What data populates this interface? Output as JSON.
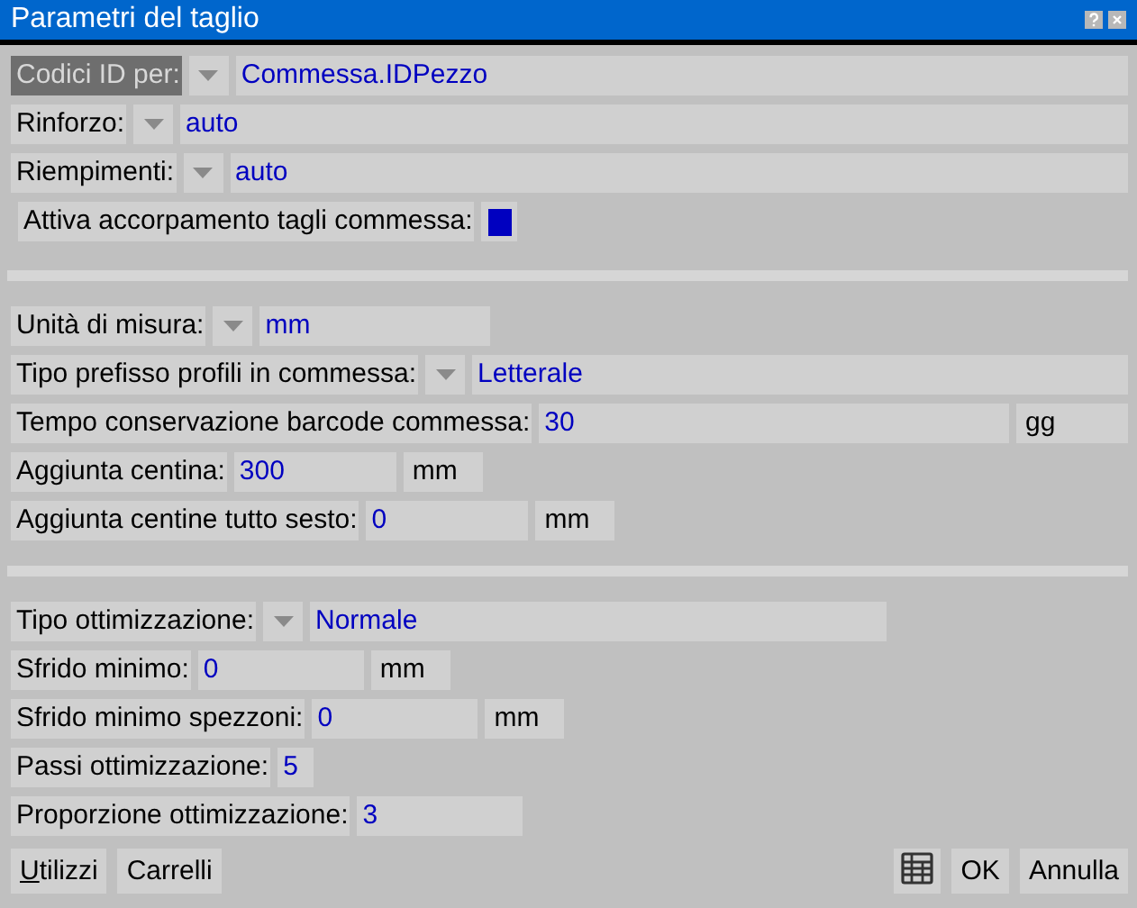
{
  "window": {
    "title": "Parametri del taglio"
  },
  "sections": [
    {
      "rows": [
        {
          "kind": "dropdown",
          "label": "Codici ID per:",
          "focused": true,
          "value": "Commessa.IDPezzo"
        },
        {
          "kind": "dropdown",
          "label": "Rinforzo:",
          "focused": false,
          "value": "auto"
        },
        {
          "kind": "dropdown",
          "label": "Riempimenti:",
          "focused": false,
          "value": "auto"
        },
        {
          "kind": "checkbox",
          "label": "Attiva accorpamento tagli commessa:",
          "focused": false,
          "checked": true
        }
      ]
    },
    {
      "rows": [
        {
          "kind": "dropdown",
          "label": "Unità di misura:",
          "focused": false,
          "value": "mm"
        },
        {
          "kind": "dropdown",
          "label": "Tipo prefisso profili in commessa:",
          "focused": false,
          "value": "Letterale"
        },
        {
          "kind": "text",
          "label": "Tempo conservazione barcode commessa:",
          "focused": false,
          "value": "30",
          "unit": "gg"
        },
        {
          "kind": "text",
          "label": "Aggiunta centina:",
          "focused": false,
          "value": "300",
          "unit": "mm"
        },
        {
          "kind": "text",
          "label": "Aggiunta centine tutto sesto:",
          "focused": false,
          "value": "0",
          "unit": "mm"
        }
      ]
    },
    {
      "rows": [
        {
          "kind": "dropdown",
          "label": "Tipo ottimizzazione:",
          "focused": false,
          "value": "Normale"
        },
        {
          "kind": "text",
          "label": "Sfrido minimo:",
          "focused": false,
          "value": "0",
          "unit": "mm"
        },
        {
          "kind": "text",
          "label": "Sfrido minimo spezzoni:",
          "focused": false,
          "value": "0",
          "unit": "mm"
        },
        {
          "kind": "text",
          "label": "Passi ottimizzazione:",
          "focused": false,
          "value": "5"
        },
        {
          "kind": "text",
          "label": "Proporzione ottimizzazione:",
          "focused": false,
          "value": "3"
        }
      ]
    }
  ],
  "buttons_left": [
    {
      "label": "Utilizzi",
      "mnemonic_underlined": true
    },
    {
      "label": "Carrelli",
      "mnemonic_underlined": false
    }
  ],
  "buttons_right": [
    {
      "kind": "icon"
    },
    {
      "kind": "text",
      "label": "OK"
    },
    {
      "kind": "text",
      "label": "Annulla"
    }
  ]
}
